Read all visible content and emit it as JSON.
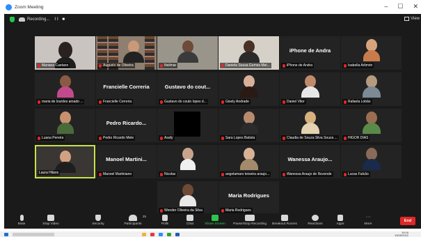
{
  "window": {
    "title": "Zoom Meeting",
    "controls": [
      "–",
      "☐",
      "✕"
    ]
  },
  "meeting": {
    "recording_label": "Recording...",
    "recording_controls": "II ■",
    "view_label": "View"
  },
  "tiles": [
    {
      "name": "Mariana Caetano"
    },
    {
      "name": "Augusto de Oliveira"
    },
    {
      "name": "Neilmar"
    },
    {
      "name": "Daniela Sousa Gomes Mei..."
    },
    {
      "big": "iPhone de Andra",
      "name": "iPhone de Andra"
    },
    {
      "name": "Isabella Arlimrin"
    },
    {
      "name": "maria de lourdes amado ..."
    },
    {
      "big": "Francielle Correria",
      "name": "Francielle Correria"
    },
    {
      "big": "Gustavo do cout...",
      "name": "Gustavo do couto lopes d..."
    },
    {
      "name": "Gisely Andrade"
    },
    {
      "name": "Daniel Vitor"
    },
    {
      "name": "Rafaela Lobão"
    },
    {
      "name": "Luana Pereira"
    },
    {
      "big": "Pedro Ricardo...",
      "name": "Pedro Ricardo Mele"
    },
    {
      "name": "Asafy"
    },
    {
      "name": "Sara Lopes Batista"
    },
    {
      "name": "Claudia de Souza Silva Souza ..."
    },
    {
      "name": "HIGOR DIAS"
    },
    {
      "name": "Laura Hilario"
    },
    {
      "big": "Manoel Martini...",
      "name": "Manoel Martiniano"
    },
    {
      "name": "Nicolas"
    },
    {
      "name": "angelamaro teixeira araujo..."
    },
    {
      "big": "Wanessa Araujo...",
      "name": "Wanessa Araujo de Rezende"
    },
    {
      "name": "Lucas Falcão"
    },
    {
      "name": "Wender Oliveira da Silva"
    },
    {
      "big": "Maria Rodrigues",
      "name": "Maria Rodrigues"
    }
  ],
  "toolbar": {
    "mute": "Mute",
    "stop_video": "Stop Video",
    "security": "Security",
    "participants": "Participants",
    "participants_count": "25",
    "polls": "Polls",
    "chat": "Chat",
    "share_screen": "Share Screen",
    "pause_recording": "Pause/Stop Recording",
    "breakout_rooms": "Breakout Rooms",
    "reactions": "Reactions",
    "apps": "Apps",
    "more": "More",
    "end": "End"
  },
  "taskbar": {
    "time": "19:16",
    "date": "19/09/2022"
  },
  "colors": {
    "meeting_bg": "#1a1a1a",
    "tile_bg": "#232323",
    "active_speaker": "#c9e24a",
    "muted_mic": "#e02828",
    "share_green": "#2ec34f",
    "end_red": "#e02828"
  }
}
